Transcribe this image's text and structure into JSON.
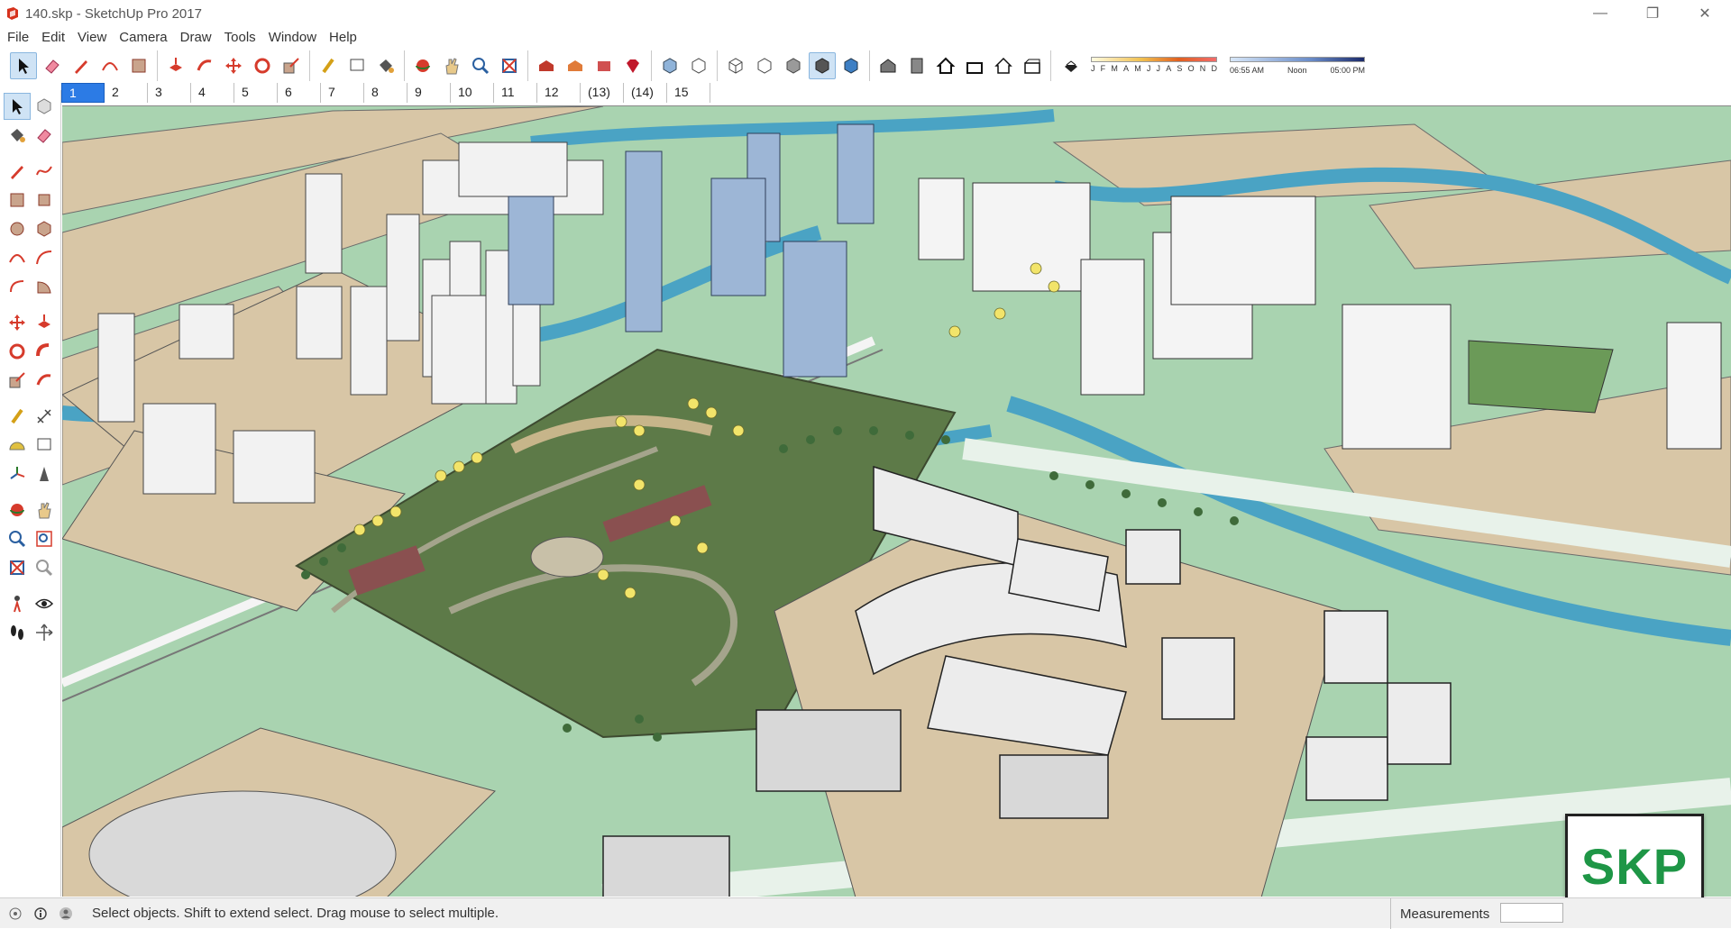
{
  "window": {
    "title": "140.skp - SketchUp Pro 2017",
    "minimize": "—",
    "restore": "❐",
    "close": "✕"
  },
  "menu": [
    "File",
    "Edit",
    "View",
    "Camera",
    "Draw",
    "Tools",
    "Window",
    "Help"
  ],
  "shadow": {
    "months": [
      "J",
      "F",
      "M",
      "A",
      "M",
      "J",
      "J",
      "A",
      "S",
      "O",
      "N",
      "D"
    ],
    "time_start": "06:55 AM",
    "time_mid": "Noon",
    "time_end": "05:00 PM"
  },
  "scene_tabs": [
    "1",
    "2",
    "3",
    "4",
    "5",
    "6",
    "7",
    "8",
    "9",
    "10",
    "11",
    "12",
    "(13)",
    "(14)",
    "15"
  ],
  "active_scene": "1",
  "status": {
    "hint": "Select objects. Shift to extend select. Drag mouse to select multiple.",
    "measurements_label": "Measurements",
    "measurements_value": ""
  },
  "watermark": "SKP",
  "colors": {
    "ground_green": "#a9d3b0",
    "sand": "#d8c6a6",
    "water": "#4aa3c4",
    "park_green": "#5d7a48",
    "accent_blue": "#2c7be5",
    "watermark_green": "#1e9646"
  }
}
